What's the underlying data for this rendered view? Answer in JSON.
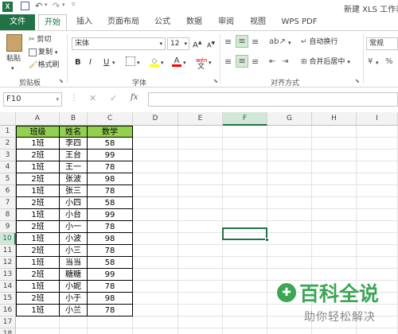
{
  "window": {
    "title": "新建 XLS 工作表"
  },
  "tabs": [
    "文件",
    "开始",
    "插入",
    "页面布局",
    "公式",
    "数据",
    "审阅",
    "视图",
    "WPS PDF"
  ],
  "ribbon": {
    "clipboard": {
      "paste": "粘贴",
      "cut": "剪切",
      "copy": "复制",
      "format_painter": "格式刷",
      "label": "剪贴板"
    },
    "font": {
      "name": "宋体",
      "size": "12",
      "label": "字体",
      "bold": "B",
      "italic": "I",
      "underline": "U",
      "pinyin": "wén"
    },
    "alignment": {
      "wrap": "自动换行",
      "merge": "合并后居中",
      "label": "对齐方式"
    },
    "number": {
      "format": "常规"
    }
  },
  "formula_bar": {
    "name_box": "F10",
    "fx": "fx",
    "value": ""
  },
  "columns": [
    "A",
    "B",
    "C",
    "D",
    "E",
    "F",
    "G",
    "H",
    "I"
  ],
  "rows": [
    "1",
    "2",
    "3",
    "4",
    "5",
    "6",
    "7",
    "8",
    "9",
    "10",
    "11",
    "12",
    "13",
    "14",
    "15",
    "16",
    "17",
    "18"
  ],
  "table": {
    "headers": [
      "班级",
      "姓名",
      "数学"
    ],
    "rows": [
      [
        "1班",
        "李四",
        "58"
      ],
      [
        "2班",
        "王台",
        "99"
      ],
      [
        "1班",
        "王一",
        "78"
      ],
      [
        "2班",
        "张波",
        "98"
      ],
      [
        "1班",
        "张三",
        "78"
      ],
      [
        "2班",
        "小四",
        "58"
      ],
      [
        "1班",
        "小台",
        "99"
      ],
      [
        "2班",
        "小一",
        "78"
      ],
      [
        "1班",
        "小波",
        "98"
      ],
      [
        "2班",
        "小三",
        "78"
      ],
      [
        "1班",
        "当当",
        "58"
      ],
      [
        "2班",
        "糖糖",
        "99"
      ],
      [
        "1班",
        "小妮",
        "78"
      ],
      [
        "2班",
        "小于",
        "98"
      ],
      [
        "1班",
        "小兰",
        "78"
      ]
    ]
  },
  "watermark": {
    "title": "百科全说",
    "subtitle": "助你轻松解决"
  },
  "colors": {
    "accent": "#217346",
    "header_fill": "#92d050",
    "selection": "#217346"
  }
}
